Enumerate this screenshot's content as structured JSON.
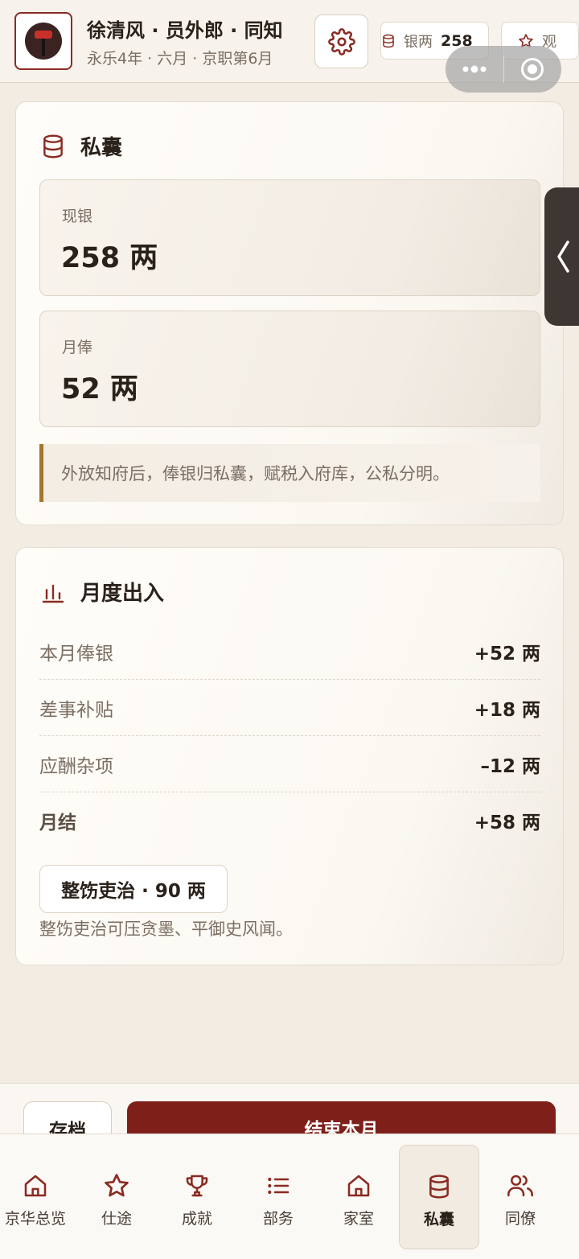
{
  "header": {
    "title": "徐清风 · 员外郎 · 同知",
    "subtitle": "永乐4年 · 六月 · 京职第6月",
    "silver_label": "银两",
    "silver_value": "258",
    "view_label": "观",
    "avatar_icon": "official-portrait-icon",
    "settings_icon": "gear-icon"
  },
  "purse": {
    "title": "私囊",
    "icon": "database-icon",
    "cash_label": "现银",
    "cash_value": "258 两",
    "salary_label": "月俸",
    "salary_value": "52 两",
    "note": "外放知府后，俸银归私囊，赋税入府库，公私分明。"
  },
  "monthly": {
    "title": "月度出入",
    "icon": "bar-chart-icon",
    "rows": [
      {
        "label": "本月俸银",
        "value": "+52 两"
      },
      {
        "label": "差事补贴",
        "value": "+18 两"
      },
      {
        "label": "应酬杂项",
        "value": "–12 两"
      },
      {
        "label": "月结",
        "value": "+58 两"
      }
    ],
    "action_button": "整饬吏治 · 90 两",
    "action_desc": "整饬吏治可压贪墨、平御史风闻。"
  },
  "action_bar": {
    "save_label": "存档",
    "end_label": "结束本月"
  },
  "tabs": [
    {
      "label": "京华总览",
      "icon": "home-icon"
    },
    {
      "label": "仕途",
      "icon": "star-icon"
    },
    {
      "label": "成就",
      "icon": "trophy-icon"
    },
    {
      "label": "部务",
      "icon": "list-icon"
    },
    {
      "label": "家室",
      "icon": "home-icon"
    },
    {
      "label": "私囊",
      "icon": "database-icon",
      "active": true
    },
    {
      "label": "同僚",
      "icon": "users-icon"
    }
  ],
  "colors": {
    "accent": "#8a2b22",
    "primary_button": "#7f1f1a",
    "note_bar": "#a4772c",
    "background": "#f2ece3"
  }
}
